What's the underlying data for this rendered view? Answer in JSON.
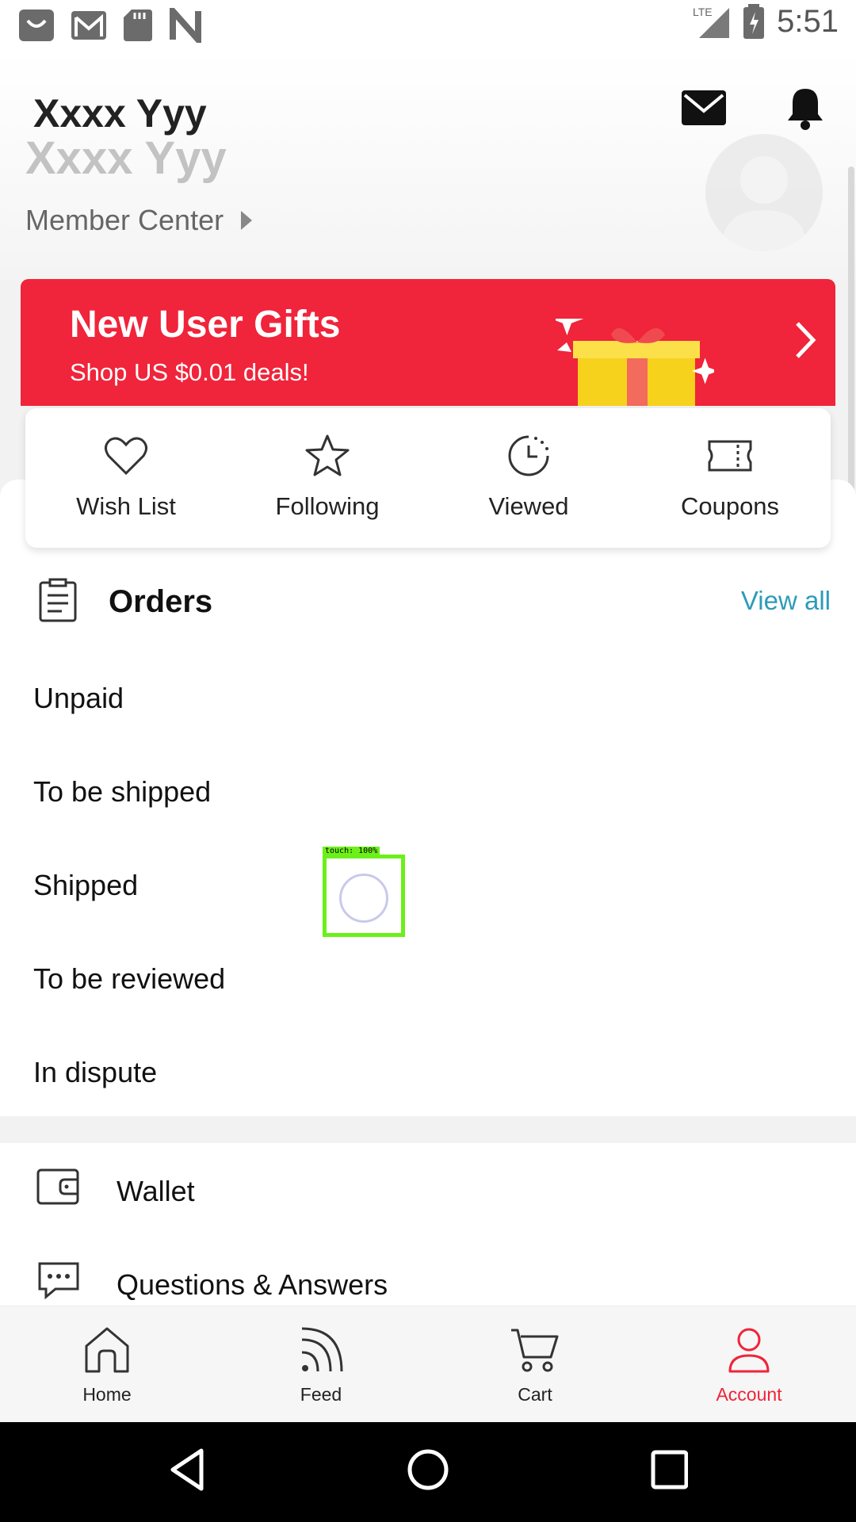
{
  "status_bar": {
    "time": "5:51",
    "network": "LTE"
  },
  "header": {
    "user_name": "Xxxx Yyy",
    "member_center": "Member Center"
  },
  "banner": {
    "title": "New User Gifts",
    "subtitle": "Shop US $0.01 deals!"
  },
  "quick_actions": [
    {
      "label": "Wish List",
      "icon": "heart-icon"
    },
    {
      "label": "Following",
      "icon": "star-icon"
    },
    {
      "label": "Viewed",
      "icon": "clock-icon"
    },
    {
      "label": "Coupons",
      "icon": "coupon-icon"
    }
  ],
  "orders": {
    "title": "Orders",
    "view_all": "View all",
    "items": [
      "Unpaid",
      "To be shipped",
      "Shipped",
      "To be reviewed",
      "In dispute"
    ]
  },
  "touch_overlay": {
    "label": "touch: 100%"
  },
  "menu": [
    {
      "label": "Wallet",
      "icon": "wallet-icon"
    },
    {
      "label": "Questions & Answers",
      "icon": "chat-bubble-icon"
    }
  ],
  "bottom_nav": [
    {
      "label": "Home",
      "icon": "home-icon",
      "active": false
    },
    {
      "label": "Feed",
      "icon": "feed-icon",
      "active": false
    },
    {
      "label": "Cart",
      "icon": "cart-icon",
      "active": false
    },
    {
      "label": "Account",
      "icon": "account-icon",
      "active": true
    }
  ],
  "colors": {
    "accent": "#f0243a",
    "link": "#2d9bb8",
    "touch": "#6cf019"
  }
}
